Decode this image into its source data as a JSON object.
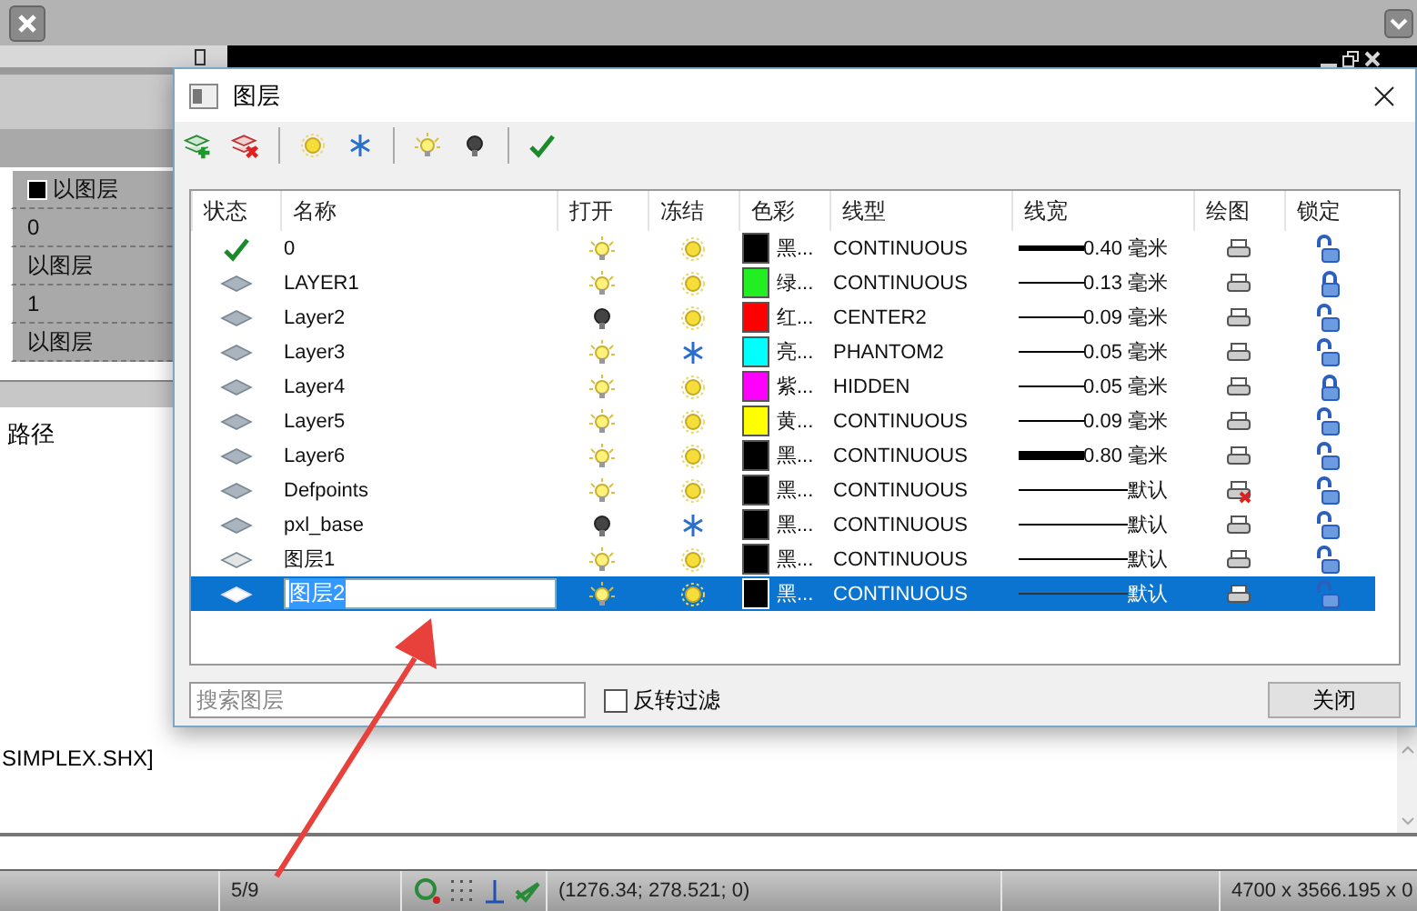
{
  "background": {
    "properties": [
      {
        "kind": "color",
        "text": "以图层"
      },
      {
        "kind": "text",
        "text": "0"
      },
      {
        "kind": "text",
        "text": "以图层"
      },
      {
        "kind": "text",
        "text": "1"
      },
      {
        "kind": "text",
        "text": "以图层"
      }
    ],
    "path_label": "路径",
    "command_text": "SIMPLEX.SHX]"
  },
  "dialog": {
    "title": "图层",
    "columns": [
      "状态",
      "名称",
      "打开",
      "冻结",
      "色彩",
      "线型",
      "线宽",
      "绘图",
      "锁定"
    ],
    "layers": [
      {
        "name": "0",
        "kind": "current",
        "on": true,
        "frozen": false,
        "color": "#000000",
        "color_label": "黑...",
        "linetype": "CONTINUOUS",
        "lineweight": "0.40 毫米",
        "plot": true,
        "locked": false,
        "selected": false
      },
      {
        "name": "LAYER1",
        "kind": "layer",
        "on": true,
        "frozen": false,
        "color": "#22ee22",
        "color_label": "绿...",
        "linetype": "CONTINUOUS",
        "lineweight": "0.13 毫米",
        "plot": true,
        "locked": true,
        "selected": false
      },
      {
        "name": "Layer2",
        "kind": "layer",
        "on": false,
        "frozen": false,
        "color": "#ff0000",
        "color_label": "红...",
        "linetype": "CENTER2",
        "lineweight": "0.09 毫米",
        "plot": true,
        "locked": false,
        "selected": false
      },
      {
        "name": "Layer3",
        "kind": "layer",
        "on": true,
        "frozen": true,
        "color": "#00ffff",
        "color_label": "亮...",
        "linetype": "PHANTOM2",
        "lineweight": "0.05 毫米",
        "plot": true,
        "locked": false,
        "selected": false
      },
      {
        "name": "Layer4",
        "kind": "layer",
        "on": true,
        "frozen": false,
        "color": "#ff00ff",
        "color_label": "紫...",
        "linetype": "HIDDEN",
        "lineweight": "0.05 毫米",
        "plot": true,
        "locked": true,
        "selected": false
      },
      {
        "name": "Layer5",
        "kind": "layer",
        "on": true,
        "frozen": false,
        "color": "#ffff00",
        "color_label": "黄...",
        "linetype": "CONTINUOUS",
        "lineweight": "0.09 毫米",
        "plot": true,
        "locked": false,
        "selected": false
      },
      {
        "name": "Layer6",
        "kind": "layer",
        "on": true,
        "frozen": false,
        "color": "#000000",
        "color_label": "黑...",
        "linetype": "CONTINUOUS",
        "lineweight": "0.80 毫米",
        "plot": true,
        "locked": false,
        "selected": false
      },
      {
        "name": "Defpoints",
        "kind": "layer",
        "on": true,
        "frozen": false,
        "color": "#000000",
        "color_label": "黑...",
        "linetype": "CONTINUOUS",
        "lineweight": "默认",
        "plot": false,
        "locked": false,
        "selected": false
      },
      {
        "name": "pxl_base",
        "kind": "layer",
        "on": false,
        "frozen": true,
        "color": "#000000",
        "color_label": "黑...",
        "linetype": "CONTINUOUS",
        "lineweight": "默认",
        "plot": true,
        "locked": false,
        "selected": false
      },
      {
        "name": "图层1",
        "kind": "unused",
        "on": true,
        "frozen": false,
        "color": "#000000",
        "color_label": "黑...",
        "linetype": "CONTINUOUS",
        "lineweight": "默认",
        "plot": true,
        "locked": false,
        "selected": false
      },
      {
        "name": "图层2",
        "kind": "layer",
        "on": true,
        "frozen": false,
        "color": "#000000",
        "color_label": "黑...",
        "linetype": "CONTINUOUS",
        "lineweight": "默认",
        "plot": true,
        "locked": false,
        "selected": true
      }
    ],
    "search": {
      "placeholder": "搜索图层"
    },
    "invert_filter": {
      "label": "反转过滤",
      "checked": false
    },
    "close_button": "关闭"
  },
  "status_bar": {
    "page": "5/9",
    "coordinates": "(1276.34; 278.521; 0)",
    "extent": "4700 x 3566.195 x 0"
  }
}
